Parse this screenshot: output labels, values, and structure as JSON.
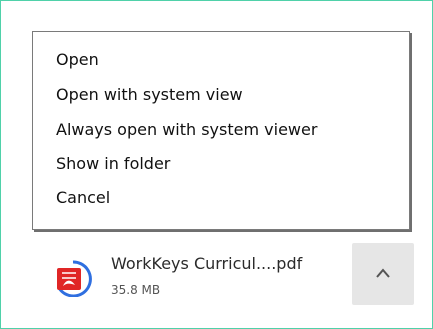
{
  "context_menu": {
    "items": [
      {
        "label": "Open"
      },
      {
        "label": "Open with system view"
      },
      {
        "label": "Always open with system viewer"
      },
      {
        "label": "Show in folder"
      },
      {
        "label": "Cancel"
      }
    ]
  },
  "download": {
    "file_name": "WorkKeys Curricul....pdf",
    "file_size": "35.8 MB",
    "icon": "pdf-file-icon"
  },
  "expand_button": {
    "icon": "chevron-up-icon"
  },
  "colors": {
    "frame_border": "#4fd1a9",
    "pdf_red": "#e02626",
    "pdf_blue": "#2f6fe0"
  }
}
